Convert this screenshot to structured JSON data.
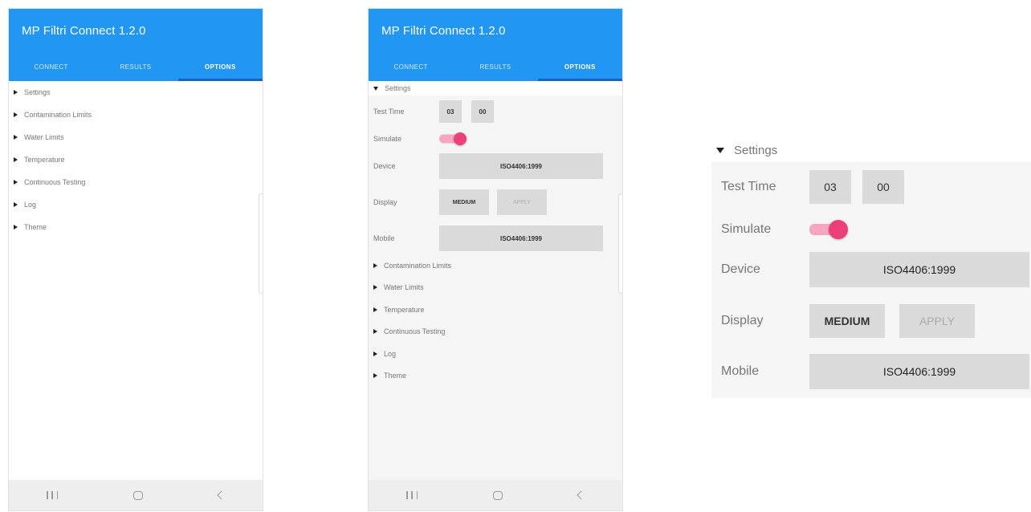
{
  "app": {
    "title": "MP Filtri Connect 1.2.0"
  },
  "tabs": [
    "CONNECT",
    "RESULTS",
    "OPTIONS"
  ],
  "active_tab": "OPTIONS",
  "menu": {
    "settings": "Settings",
    "contamination_limits": "Contamination Limits",
    "water_limits": "Water Limits",
    "temperature": "Temperature",
    "continuous_testing": "Continuous Testing",
    "log": "Log",
    "theme": "Theme"
  },
  "settings": {
    "test_time_label": "Test Time",
    "test_time_min": "03",
    "test_time_sec": "00",
    "simulate_label": "Simulate",
    "simulate_on": true,
    "device_label": "Device",
    "device_value": "ISO4406:1999",
    "display_label": "Display",
    "display_value": "MEDIUM",
    "apply_label": "APPLY",
    "mobile_label": "Mobile",
    "mobile_value": "ISO4406:1999"
  },
  "colors": {
    "appbar": "#2196f3",
    "toggle_thumb": "#ec407a",
    "toggle_track": "#f7a6c2"
  },
  "icons": [
    "recent-apps-icon",
    "home-icon",
    "back-icon",
    "expand-arrow-icon",
    "collapse-arrow-icon"
  ]
}
